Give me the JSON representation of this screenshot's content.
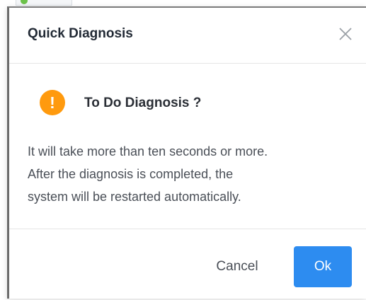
{
  "dialog": {
    "title": "Quick Diagnosis",
    "close_icon": "close-icon",
    "confirm_icon": "warning-exclamation-icon",
    "confirm_icon_glyph": "!",
    "confirm_icon_color": "#ff9a0e",
    "heading": "To Do Diagnosis ?",
    "message_lines": [
      "It will take more than ten seconds or more.",
      "After the diagnosis is completed, the",
      "system will be restarted automatically."
    ],
    "cancel_label": "Cancel",
    "ok_label": "Ok",
    "primary_color": "#2d8cf0"
  }
}
